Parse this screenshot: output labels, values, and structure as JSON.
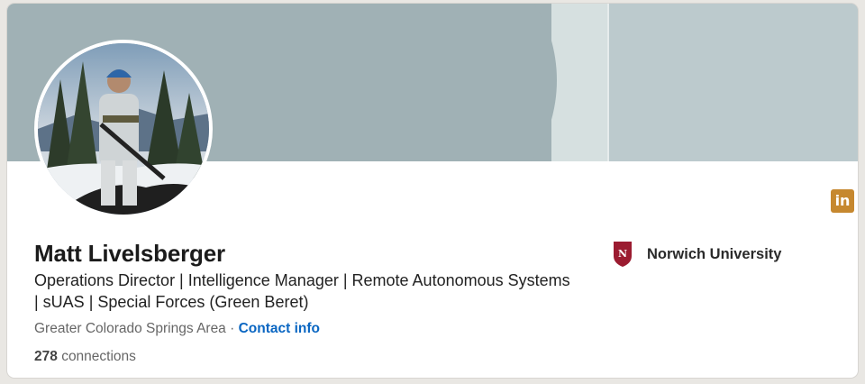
{
  "profile": {
    "name": "Matt Livelsberger",
    "headline": "Operations Director | Intelligence Manager | Remote Autonomous Systems | sUAS | Special Forces (Green Beret)",
    "location": "Greater Colorado Springs Area",
    "separator": "·",
    "contact_label": "Contact info",
    "connections_count": "278",
    "connections_label": "connections"
  },
  "education": {
    "school": "Norwich University",
    "logo_letter": "N"
  },
  "badge": {
    "icon": "linkedin-icon",
    "label": "in"
  },
  "colors": {
    "link": "#0a66c2",
    "banner": "#a0b1b5",
    "badge": "#c6882f"
  }
}
